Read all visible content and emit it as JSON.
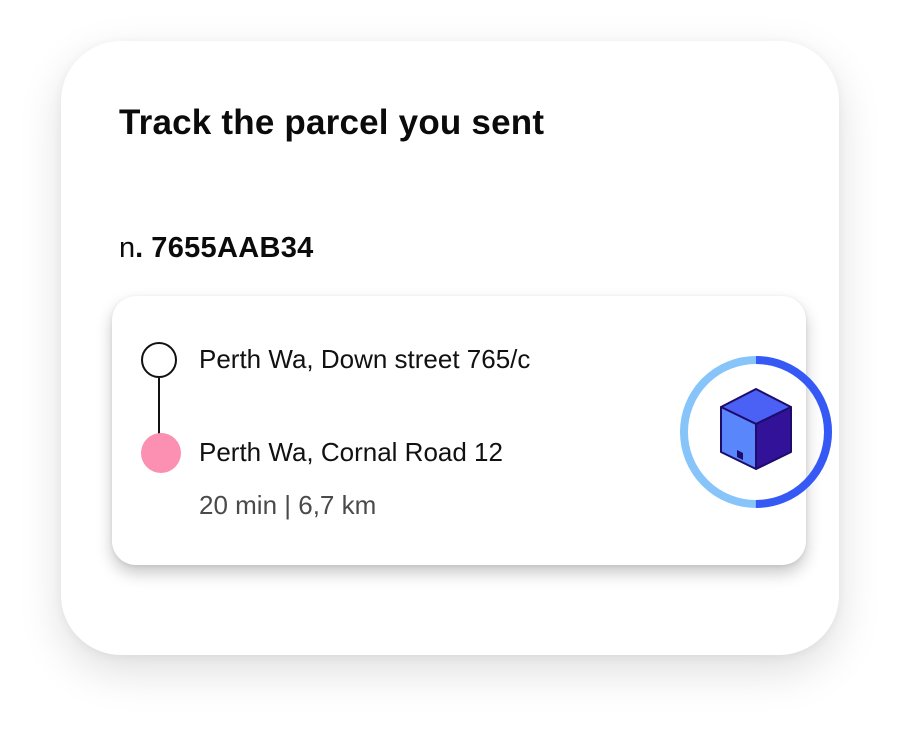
{
  "card": {
    "title": "Track the parcel you sent",
    "parcel_prefix": "n",
    "parcel_dot": ".",
    "parcel_number": "7655AAB34"
  },
  "route": {
    "origin": "Perth Wa, Down street 765/c",
    "destination": "Perth Wa, Cornal Road 12",
    "trip_info": "20 min | 6,7 km",
    "progress_fraction": 0.5
  },
  "colors": {
    "destination_dot": "#fb90b2",
    "ring_progress": "#3659f6",
    "ring_track": "#86c4fa",
    "box_top": "#4b61f5",
    "box_left": "#5a86fb",
    "box_right": "#33129a",
    "box_outline": "#1d0c6b"
  },
  "icons": {
    "parcel": "parcel-box-icon"
  }
}
